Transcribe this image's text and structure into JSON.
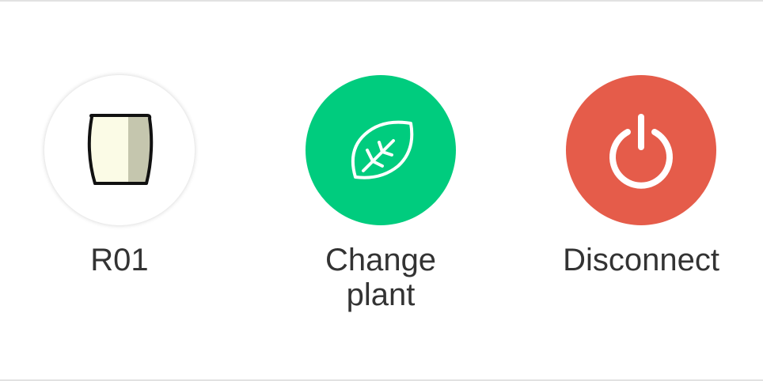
{
  "actions": {
    "pot": {
      "label": "R01",
      "icon": "pot-icon"
    },
    "change_plant": {
      "label": "Change plant",
      "icon": "leaf-icon",
      "color": "#00cc7e"
    },
    "disconnect": {
      "label": "Disconnect",
      "icon": "power-icon",
      "color": "#e55c4a"
    }
  },
  "colors": {
    "text": "#333333",
    "divider": "#e2e2e2",
    "pot_body": "#fbfbe6",
    "pot_shade": "#c5c6ae"
  }
}
